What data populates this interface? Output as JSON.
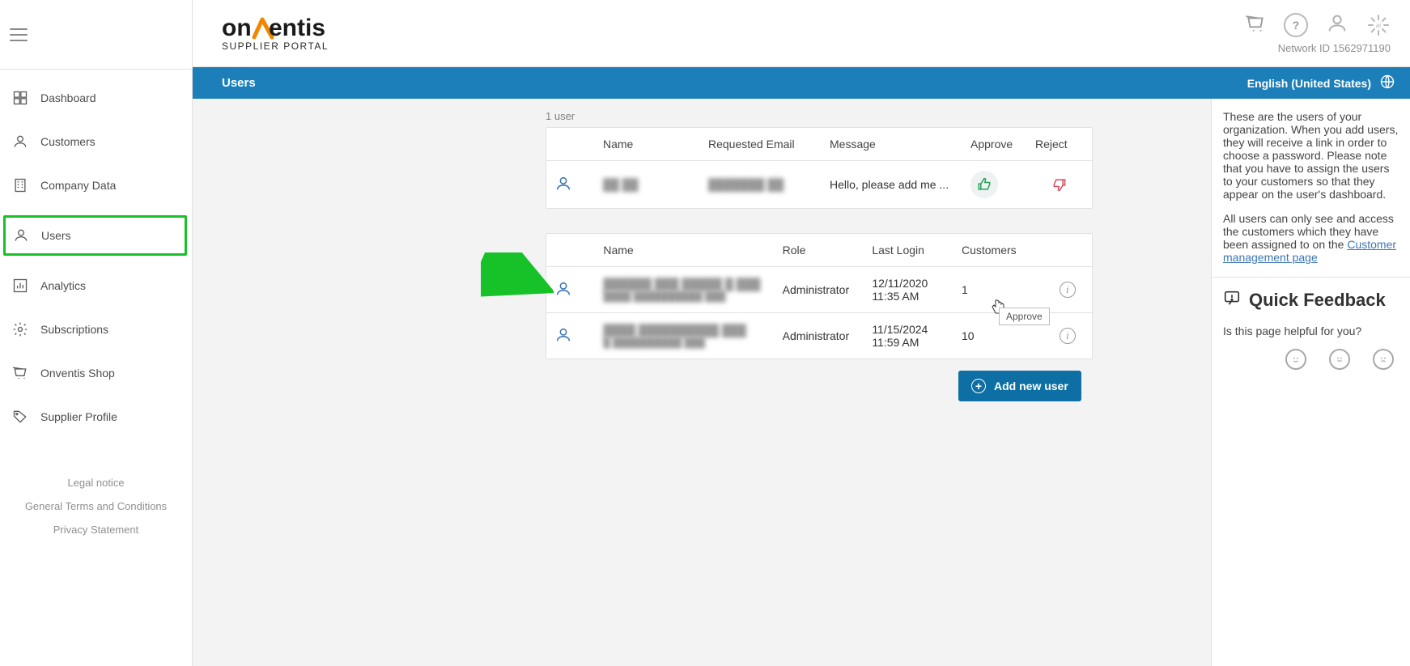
{
  "brand": {
    "name": "onventis",
    "sub": "SUPPLIER PORTAL"
  },
  "header": {
    "network_id": "Network ID 1562971190"
  },
  "sidebar": {
    "items": [
      {
        "label": "Dashboard"
      },
      {
        "label": "Customers"
      },
      {
        "label": "Company Data"
      },
      {
        "label": "Users"
      },
      {
        "label": "Analytics"
      },
      {
        "label": "Subscriptions"
      },
      {
        "label": "Onventis Shop"
      },
      {
        "label": "Supplier Profile"
      }
    ],
    "legal": [
      "Legal notice",
      "General Terms and Conditions",
      "Privacy Statement"
    ]
  },
  "pagebar": {
    "title": "Users",
    "language": "English (United States)"
  },
  "pending": {
    "count_label": "1 user",
    "headers": {
      "name": "Name",
      "email": "Requested Email",
      "message": "Message",
      "approve": "Approve",
      "reject": "Reject"
    },
    "row": {
      "name": "██ ██",
      "email": "███████ ██",
      "message": "Hello, please add me ...",
      "approve_tooltip": "Approve"
    }
  },
  "users": {
    "headers": {
      "name": "Name",
      "role": "Role",
      "last_login": "Last Login",
      "customers": "Customers"
    },
    "rows": [
      {
        "name_line1": "██████ ███ █████ █ ███",
        "name_line2": "████ ██████████ ███",
        "role": "Administrator",
        "last_login_date": "12/11/2020",
        "last_login_time": "11:35 AM",
        "customers": "1"
      },
      {
        "name_line1": "████ ██████████ ███",
        "name_line2": "█ ██████████ ███",
        "role": "Administrator",
        "last_login_date": "11/15/2024",
        "last_login_time": "11:59 AM",
        "customers": "10"
      }
    ]
  },
  "actions": {
    "add_new_user": "Add new user"
  },
  "help": {
    "para1": "These are the users of your organization. When you add users, they will receive a link in order to choose a password. Please note that you have to assign the users to your customers so that they appear on the user's dashboard.",
    "para2_prefix": "All users can only see and access the customers which they have been assigned to on the ",
    "para2_link": "Customer management page"
  },
  "feedback": {
    "title": "Quick Feedback",
    "question": "Is this page helpful for you?"
  }
}
